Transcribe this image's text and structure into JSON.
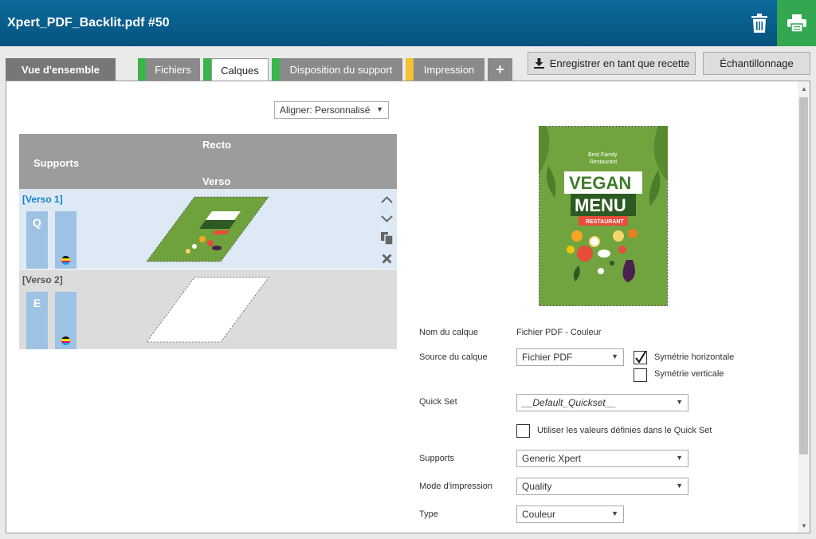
{
  "app": {
    "title": "Xpert_PDF_Backlit.pdf #50"
  },
  "tabs": [
    {
      "label": "Vue d'ensemble"
    },
    {
      "label": "Fichiers"
    },
    {
      "label": "Calques"
    },
    {
      "label": "Disposition du support"
    },
    {
      "label": "Impression"
    }
  ],
  "add_tab": "+",
  "toolbar": {
    "save_recipe": "Enregistrer en tant que recette",
    "sampling": "Échantillonnage"
  },
  "align": {
    "value": "Aligner: Personnalisé"
  },
  "layers_table": {
    "col_supports": "Supports",
    "col_recto": "Recto",
    "col_verso": "Verso",
    "rows": [
      {
        "name": "[Verso 1]",
        "mode_letter": "Q"
      },
      {
        "name": "[Verso 2]",
        "mode_letter": "E"
      }
    ]
  },
  "thumbnail": {
    "line1": "Best Family",
    "line2": "Restaurant",
    "word1": "VEGAN",
    "word2": "MENU",
    "ribbon": "RESTAURANT"
  },
  "properties": {
    "layer_name_label": "Nom du calque",
    "layer_name_value": "Fichier PDF - Couleur",
    "layer_source_label": "Source du calque",
    "layer_source_value": "Fichier PDF",
    "mirror_h": "Symétrie horizontale",
    "mirror_v": "Symétrie verticale",
    "quickset_label": "Quick Set",
    "quickset_value": "__Default_Quickset__",
    "use_quickset": "Utiliser les valeurs définies dans le Quick Set",
    "supports_label": "Supports",
    "supports_value": "Generic Xpert",
    "print_mode_label": "Mode d'impression",
    "print_mode_value": "Quality",
    "type_label": "Type",
    "type_value": "Couleur"
  },
  "colors": {
    "header": "#0a5f8e",
    "print_button": "#34a751",
    "tab_marker_green": "#3ab54a",
    "tab_marker_yellow": "#f3c132",
    "selected_row": "#ddeaf6",
    "layer_blue": "#9ec2e4"
  }
}
